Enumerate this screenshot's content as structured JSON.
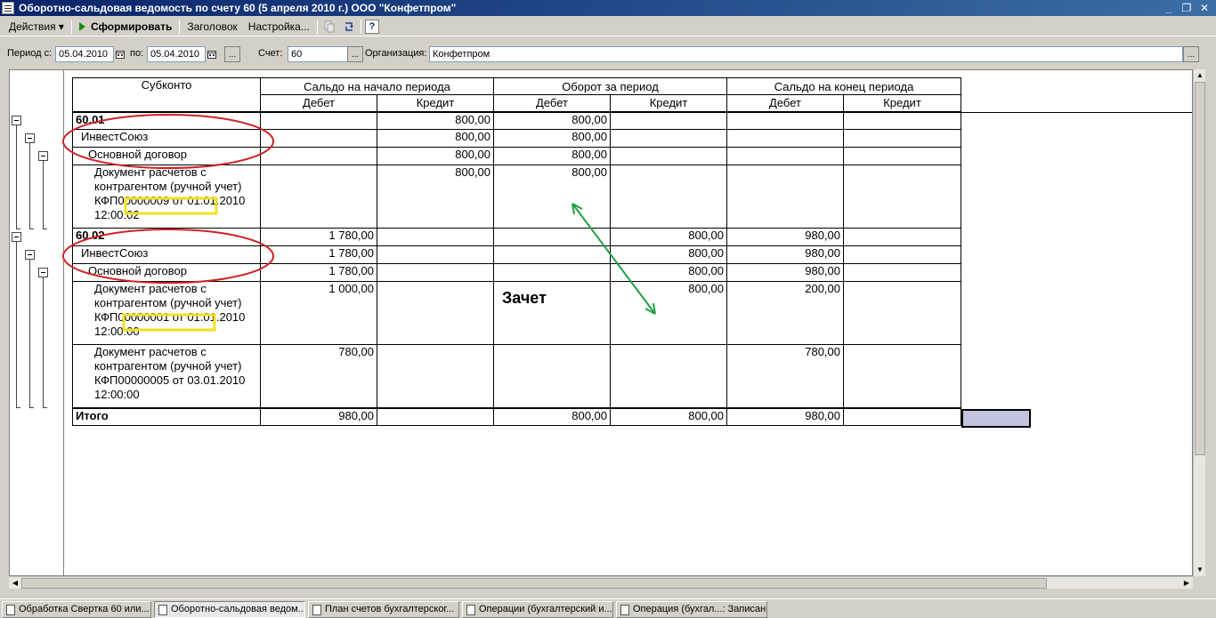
{
  "window": {
    "title": "Оборотно-сальдовая ведомость по счету 60 (5 апреля 2010 г.) ООО \"Конфетпром\"",
    "minimize": "_",
    "restore": "❐",
    "close": "✕"
  },
  "toolbar": {
    "actions": "Действия ▾",
    "generate": "Сформировать",
    "header": "Заголовок",
    "settings": "Настройка...",
    "help": "?"
  },
  "filter": {
    "period_from_label": "Период с:",
    "period_from": "05.04.2010",
    "period_to_label": "по:",
    "period_to": "05.04.2010",
    "account_label": "Счет:",
    "account": "60",
    "org_label": "Организация:",
    "org": "Конфетпром",
    "dots": "..."
  },
  "table": {
    "headers": {
      "subkonto": "Субконто",
      "opening": "Сальдо на начало периода",
      "turnover": "Оборот за период",
      "closing": "Сальдо на конец периода",
      "debit": "Дебет",
      "credit": "Кредит"
    },
    "rows": [
      {
        "name": "60.01",
        "od": "",
        "oc": "800,00",
        "td": "800,00",
        "tc": "",
        "cd": "",
        "cc": ""
      },
      {
        "name": "ИнвестСоюз",
        "od": "",
        "oc": "800,00",
        "td": "800,00",
        "tc": "",
        "cd": "",
        "cc": ""
      },
      {
        "name": "Основной договор",
        "od": "",
        "oc": "800,00",
        "td": "800,00",
        "tc": "",
        "cd": "",
        "cc": ""
      },
      {
        "name": "Документ расчетов с контрагентом (ручной учет) КФП00000009 от 01.01.2010 12:00:02",
        "od": "",
        "oc": "800,00",
        "td": "800,00",
        "tc": "",
        "cd": "",
        "cc": ""
      },
      {
        "name": "60.02",
        "od": "1 780,00",
        "oc": "",
        "td": "",
        "tc": "800,00",
        "cd": "980,00",
        "cc": ""
      },
      {
        "name": "ИнвестСоюз",
        "od": "1 780,00",
        "oc": "",
        "td": "",
        "tc": "800,00",
        "cd": "980,00",
        "cc": ""
      },
      {
        "name": "Основной договор",
        "od": "1 780,00",
        "oc": "",
        "td": "",
        "tc": "800,00",
        "cd": "980,00",
        "cc": ""
      },
      {
        "name": "Документ расчетов с контрагентом (ручной учет) КФП00000001 от 01.01.2010 12:00:00",
        "od": "1 000,00",
        "oc": "",
        "td": "",
        "tc": "800,00",
        "cd": "200,00",
        "cc": ""
      },
      {
        "name": "Документ расчетов с контрагентом (ручной учет) КФП00000005 от 03.01.2010 12:00:00",
        "od": "780,00",
        "oc": "",
        "td": "",
        "tc": "",
        "cd": "780,00",
        "cc": ""
      }
    ],
    "total": {
      "name": "Итого",
      "od": "980,00",
      "oc": "",
      "td": "800,00",
      "tc": "800,00",
      "cd": "980,00",
      "cc": ""
    }
  },
  "annotation": {
    "zachet": "Зачет"
  },
  "taskbar": [
    "Обработка  Свертка 60 или...",
    "Оборотно-сальдовая ведом...",
    "План счетов бухгалтерског...",
    "Операции (бухгалтерский и...",
    "Операция (бухгал...: Записан"
  ]
}
